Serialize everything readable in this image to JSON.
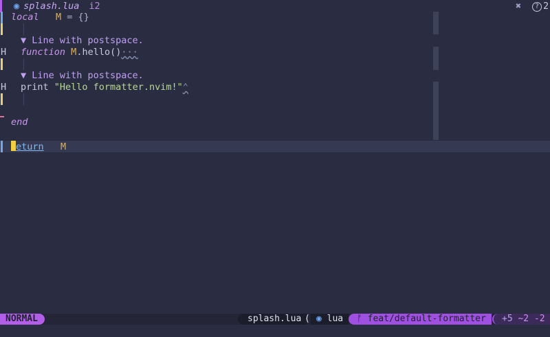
{
  "tabline": {
    "file_icon": "lua-icon",
    "filename": "splash.lua",
    "diagnostic": "i2",
    "close": "✖",
    "help": "2"
  },
  "editor": {
    "lines": {
      "l1_kw": "local",
      "l1_ident": "M",
      "l1_rest": " = {}",
      "v1": "▼ Line with postspace.",
      "l2_gutter": "H",
      "l2_kw": "function",
      "l2_ident": "M",
      "l2_rest": ".hello()",
      "l2_squig": "···",
      "v2": "▼ Line with postspace.",
      "l3_gutter": "H",
      "l3_fn": "print ",
      "l3_str": "\"Hello formatter.nvim!\"",
      "l3_squig": "⌃",
      "l4_kw": "end",
      "l5_ret": "eturn",
      "l5_ident": "M"
    }
  },
  "statusline": {
    "mode": "NORMAL",
    "filename": "splash.lua",
    "paren": "(",
    "filetype_icon": "lua-icon",
    "filetype": "lua",
    "branch_icon": "ᚠ",
    "branch": "feat/default-formatter",
    "diff_add": "+5",
    "diff_change": "~2",
    "diff_remove": "-2"
  },
  "colors": {
    "background": "#2a2d42",
    "accent": "#b35ee8",
    "cursor": "#f0d040"
  }
}
